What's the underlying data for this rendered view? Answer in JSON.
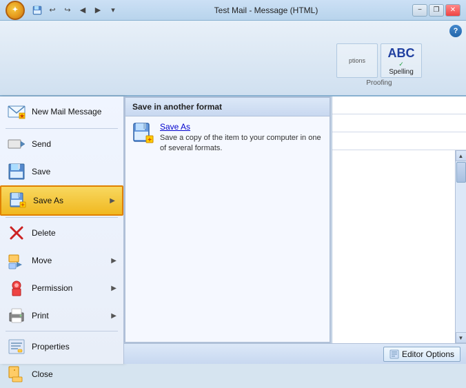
{
  "window": {
    "title": "Test Mail - Message (HTML)",
    "minimize_label": "−",
    "restore_label": "❐",
    "close_label": "✕"
  },
  "office_button": {
    "symbol": "✦"
  },
  "toolbar": {
    "save_tip": "Save",
    "undo_tip": "Undo",
    "redo_tip": "Redo",
    "back_tip": "Back",
    "forward_tip": "Forward",
    "dropdown_tip": "Customize"
  },
  "ribbon": {
    "help_label": "?",
    "proofing_group_label": "Proofing",
    "spelling_label": "Spelling",
    "abc_text": "ABC"
  },
  "menu": {
    "header": "Save in another format",
    "items": [
      {
        "id": "new-mail",
        "label": "New Mail Message",
        "has_arrow": false
      },
      {
        "id": "send",
        "label": "Send",
        "has_arrow": false
      },
      {
        "id": "save",
        "label": "Save",
        "has_arrow": false
      },
      {
        "id": "save-as",
        "label": "Save As",
        "has_arrow": true,
        "active": true
      },
      {
        "id": "delete",
        "label": "Delete",
        "has_arrow": false
      },
      {
        "id": "move",
        "label": "Move",
        "has_arrow": true
      },
      {
        "id": "permission",
        "label": "Permission",
        "has_arrow": true
      },
      {
        "id": "print",
        "label": "Print",
        "has_arrow": true
      },
      {
        "id": "properties",
        "label": "Properties",
        "has_arrow": false
      },
      {
        "id": "close",
        "label": "Close",
        "has_arrow": false
      }
    ]
  },
  "submenu": {
    "header": "Save in another format",
    "item": {
      "title": "Save As",
      "description": "Save a copy of the item to your computer in one of several formats."
    }
  },
  "editor_options": {
    "label": "Editor Options"
  },
  "email_fields": {
    "to": "",
    "cc": "",
    "subject": ""
  }
}
